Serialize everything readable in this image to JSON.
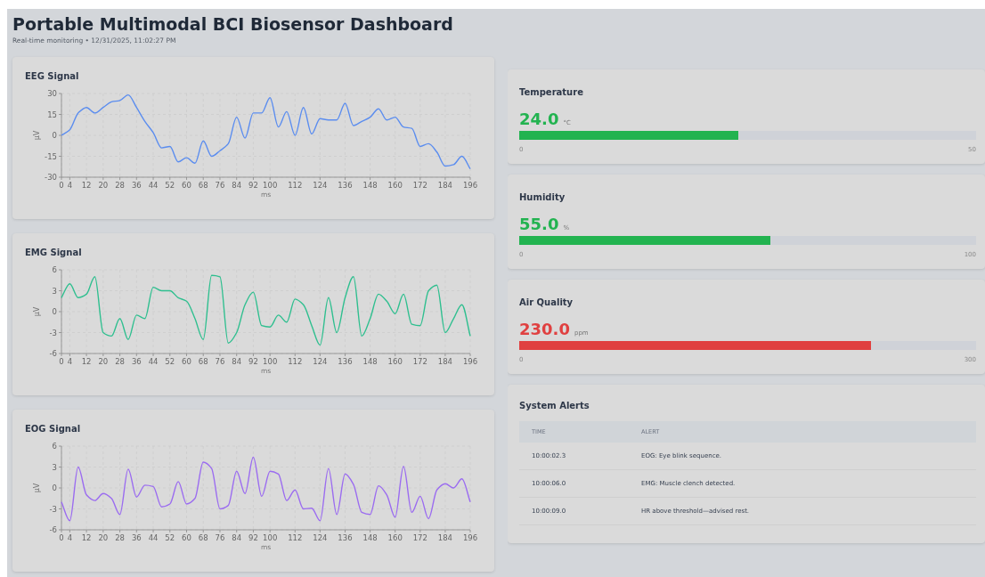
{
  "header": {
    "title": "Portable Multimodal BCI Biosensor Dashboard",
    "subtitle": "Real-time monitoring • 12/31/2025, 11:02:27 PM"
  },
  "signals": [
    {
      "title": "EEG Signal",
      "chart_data": {
        "type": "line",
        "xlabel": "ms",
        "ylabel": "μV",
        "x": [
          0,
          4,
          8,
          12,
          16,
          20,
          24,
          28,
          32,
          36,
          40,
          44,
          48,
          52,
          56,
          60,
          64,
          68,
          72,
          76,
          80,
          84,
          88,
          92,
          96,
          100,
          104,
          108,
          112,
          116,
          120,
          124,
          128,
          132,
          136,
          140,
          144,
          148,
          152,
          156,
          160,
          164,
          168,
          172,
          176,
          180,
          184,
          188,
          192,
          196
        ],
        "grid": true,
        "series": [
          {
            "color": "#5b8def",
            "values": [
              0,
              4,
              16,
              20,
              16,
              20,
              24,
              25,
              29,
              20,
              10,
              2,
              -9,
              -8,
              -19,
              -16,
              -20,
              -4,
              -15,
              -11,
              -6,
              13,
              -2,
              16,
              16,
              27,
              6,
              17,
              0,
              20,
              1,
              12,
              11,
              11,
              23,
              7,
              10,
              13,
              19,
              11,
              13,
              6,
              5,
              -8,
              -6,
              -12,
              -22,
              -21,
              -15,
              -24
            ]
          }
        ],
        "xlim": [
          0,
          196
        ],
        "ylim": [
          -30,
          30
        ],
        "xticks": [
          0,
          4,
          12,
          20,
          28,
          36,
          44,
          52,
          60,
          68,
          76,
          84,
          92,
          100,
          112,
          124,
          136,
          148,
          160,
          172,
          184,
          196
        ],
        "yticks": [
          -30,
          -15,
          0,
          15,
          30
        ]
      }
    },
    {
      "title": "EMG Signal",
      "chart_data": {
        "type": "line",
        "xlabel": "ms",
        "ylabel": "μV",
        "x": [
          0,
          4,
          8,
          12,
          16,
          20,
          24,
          28,
          32,
          36,
          40,
          44,
          48,
          52,
          56,
          60,
          64,
          68,
          72,
          76,
          80,
          84,
          88,
          92,
          96,
          100,
          104,
          108,
          112,
          116,
          120,
          124,
          128,
          132,
          136,
          140,
          144,
          148,
          152,
          156,
          160,
          164,
          168,
          172,
          176,
          180,
          184,
          188,
          192,
          196
        ],
        "grid": true,
        "series": [
          {
            "color": "#2fbf8f",
            "values": [
              2,
              4,
              2,
              2.5,
              5,
              -3,
              -3.5,
              -1,
              -4,
              -0.5,
              -1,
              3.5,
              3,
              3,
              2,
              1.5,
              -1,
              -4,
              5.2,
              5,
              -4.5,
              -3,
              1,
              2.8,
              -2,
              -2.2,
              -0.5,
              -1.5,
              1.8,
              1,
              -2,
              -4.8,
              2,
              -3,
              2,
              5,
              -3.5,
              -1,
              2.5,
              1.5,
              -0.3,
              2.5,
              -1.8,
              -2,
              3,
              3.8,
              -3,
              -1,
              1,
              -3.5
            ]
          }
        ],
        "xlim": [
          0,
          196
        ],
        "ylim": [
          -6,
          6
        ],
        "xticks": [
          0,
          4,
          12,
          20,
          28,
          36,
          44,
          52,
          60,
          68,
          76,
          84,
          92,
          100,
          112,
          124,
          136,
          148,
          160,
          172,
          184,
          196
        ],
        "yticks": [
          -6,
          -3,
          0,
          3,
          6
        ]
      }
    },
    {
      "title": "EOG Signal",
      "chart_data": {
        "type": "line",
        "xlabel": "ms",
        "ylabel": "μV",
        "x": [
          0,
          4,
          8,
          12,
          16,
          20,
          24,
          28,
          32,
          36,
          40,
          44,
          48,
          52,
          56,
          60,
          64,
          68,
          72,
          76,
          80,
          84,
          88,
          92,
          96,
          100,
          104,
          108,
          112,
          116,
          120,
          124,
          128,
          132,
          136,
          140,
          144,
          148,
          152,
          156,
          160,
          164,
          168,
          172,
          176,
          180,
          184,
          188,
          192,
          196
        ],
        "grid": true,
        "series": [
          {
            "color": "#9b6cf0",
            "values": [
              -2,
              -4.7,
              3,
              -1,
              -1.8,
              -0.8,
              -1.5,
              -3.8,
              2.7,
              -1.3,
              0.4,
              0.2,
              -2.7,
              -2.3,
              0.9,
              -2.3,
              -1.5,
              3.7,
              2.8,
              -3,
              -2.5,
              2.4,
              -0.8,
              4.4,
              -1.2,
              2.4,
              2,
              -1.8,
              -0.3,
              -3,
              -2.9,
              -4.7,
              2.8,
              -3.8,
              2,
              0.5,
              -3.5,
              -3.8,
              0.3,
              -1,
              -4.2,
              3.1,
              -3.5,
              -1.2,
              -4.4,
              -0.3,
              0.6,
              0,
              1.3,
              -2
            ]
          }
        ],
        "xlim": [
          0,
          196
        ],
        "ylim": [
          -6,
          6
        ],
        "xticks": [
          0,
          4,
          12,
          20,
          28,
          36,
          44,
          52,
          60,
          68,
          76,
          84,
          92,
          100,
          112,
          124,
          136,
          148,
          160,
          172,
          184,
          196
        ],
        "yticks": [
          -6,
          -3,
          0,
          3,
          6
        ]
      }
    }
  ],
  "gauges": [
    {
      "title": "Temperature",
      "value": "24.0",
      "unit": "°C",
      "level": 0.48,
      "color": "#22b350",
      "min": "0",
      "max": "50"
    },
    {
      "title": "Humidity",
      "value": "55.0",
      "unit": "%",
      "level": 0.55,
      "color": "#22b350",
      "min": "0",
      "max": "100"
    },
    {
      "title": "Air Quality",
      "value": "230.0",
      "unit": "ppm",
      "level": 0.77,
      "color": "#e04040",
      "min": "0",
      "max": "300"
    }
  ],
  "alerts": {
    "title": "System Alerts",
    "columns": [
      "TIME",
      "ALERT"
    ],
    "rows": [
      {
        "time": "10:00:02.3",
        "alert": "EOG: Eye blink sequence."
      },
      {
        "time": "10:00:06.0",
        "alert": "EMG: Muscle clench detected."
      },
      {
        "time": "10:00:09.0",
        "alert": "HR above threshold—advised rest."
      }
    ]
  }
}
